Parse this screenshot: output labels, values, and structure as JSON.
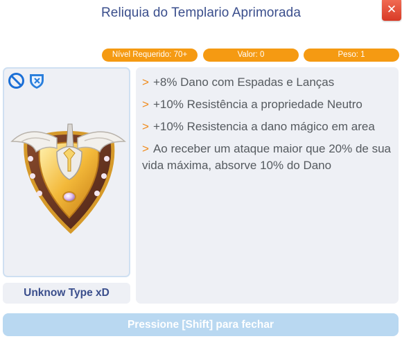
{
  "window": {
    "title": "Reliquia do Templario Aprimorada",
    "close_label": "✕"
  },
  "stats": {
    "level_required": "Nível Requerido: 70+",
    "value": "Valor: 0",
    "weight": "Peso: 1"
  },
  "item": {
    "type_label": "Unknow Type xD",
    "badges": [
      "no-trade-icon",
      "shield-icon"
    ]
  },
  "effects": [
    {
      "marker": ">",
      "text": "+8% Dano com Espadas e Lanças"
    },
    {
      "marker": ">",
      "text": "+10% Resistência a propriedade Neutro"
    },
    {
      "marker": ">",
      "text": "+10% Resistencia a dano mágico em area"
    },
    {
      "marker": ">",
      "text": "Ao receber um ataque maior que 20% de sua vida máxima, absorve 10% do Dano"
    }
  ],
  "footer": {
    "hint": "Pressione [Shift] para fechar"
  },
  "colors": {
    "title": "#3a4e8c",
    "pill": "#f59a12",
    "close": "#e04a34",
    "arrow": "#f08a1a",
    "footer": "#b9d8f1"
  }
}
